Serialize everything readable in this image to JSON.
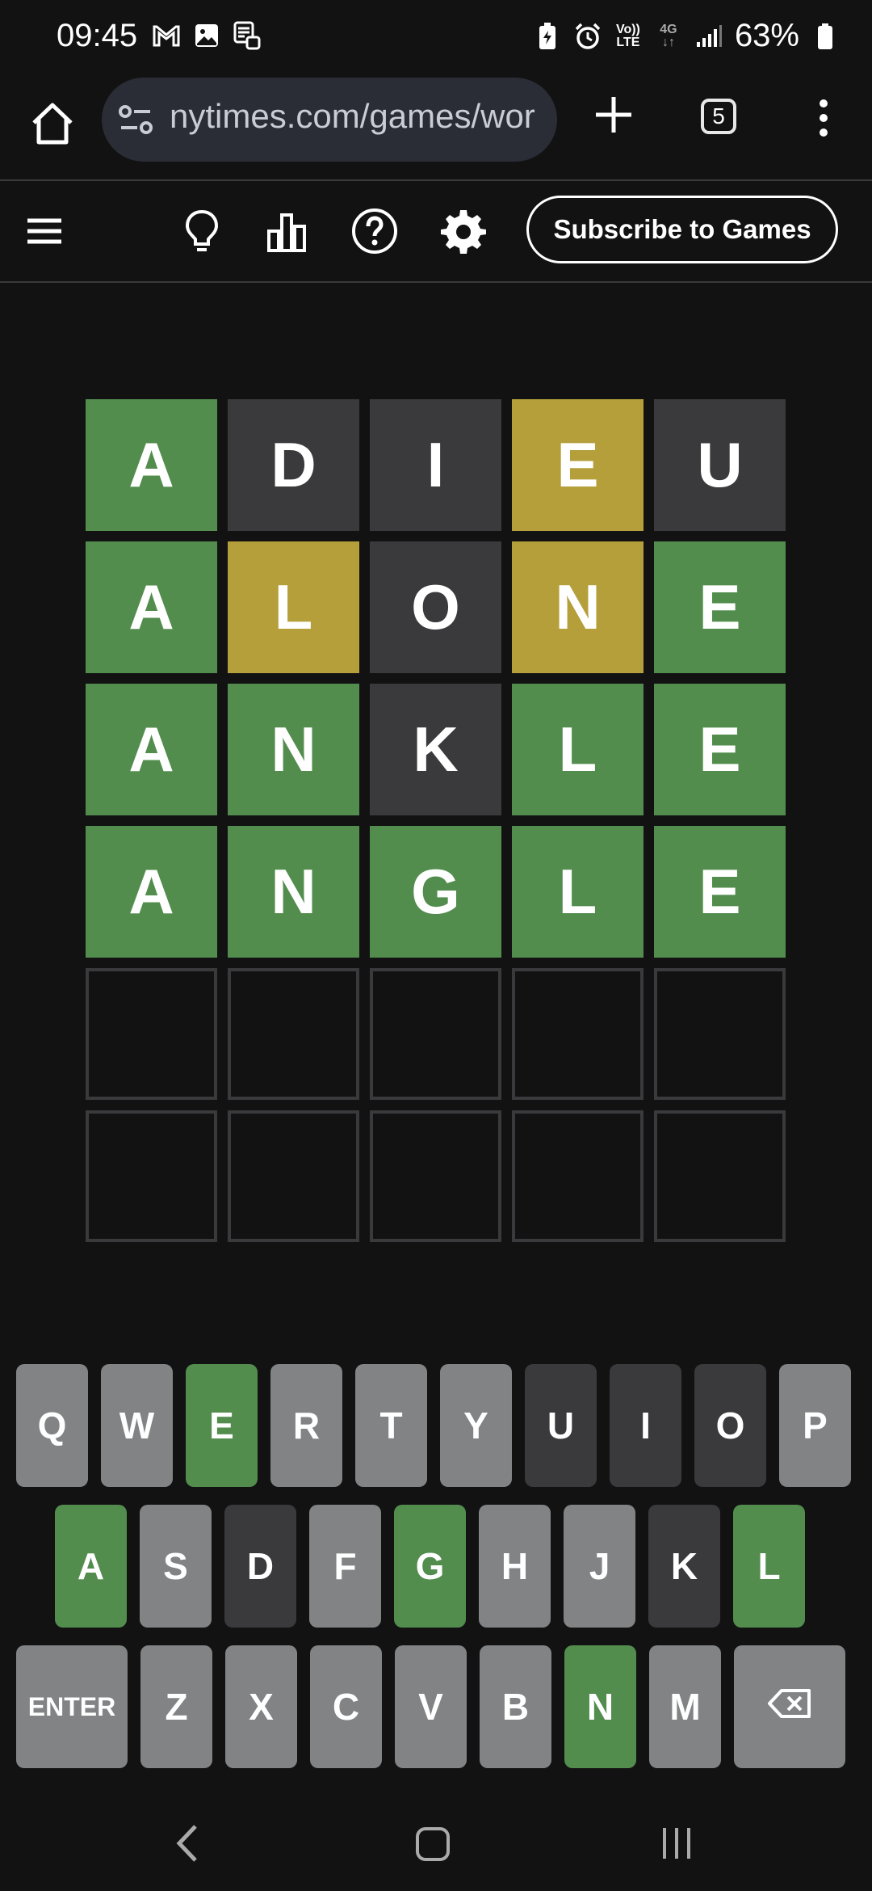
{
  "status": {
    "time": "09:45",
    "battery": "63%",
    "volte_line1": "Vo))",
    "volte_line2": "LTE",
    "net_type": "4G"
  },
  "browser": {
    "url": "nytimes.com/games/wor",
    "tab_count": "5"
  },
  "header": {
    "subscribe_label": "Subscribe to Games"
  },
  "board": {
    "rows": [
      [
        {
          "l": "A",
          "s": "correct"
        },
        {
          "l": "D",
          "s": "absent"
        },
        {
          "l": "I",
          "s": "absent"
        },
        {
          "l": "E",
          "s": "present"
        },
        {
          "l": "U",
          "s": "absent"
        }
      ],
      [
        {
          "l": "A",
          "s": "correct"
        },
        {
          "l": "L",
          "s": "present"
        },
        {
          "l": "O",
          "s": "absent"
        },
        {
          "l": "N",
          "s": "present"
        },
        {
          "l": "E",
          "s": "correct"
        }
      ],
      [
        {
          "l": "A",
          "s": "correct"
        },
        {
          "l": "N",
          "s": "correct"
        },
        {
          "l": "K",
          "s": "absent"
        },
        {
          "l": "L",
          "s": "correct"
        },
        {
          "l": "E",
          "s": "correct"
        }
      ],
      [
        {
          "l": "A",
          "s": "correct"
        },
        {
          "l": "N",
          "s": "correct"
        },
        {
          "l": "G",
          "s": "correct"
        },
        {
          "l": "L",
          "s": "correct"
        },
        {
          "l": "E",
          "s": "correct"
        }
      ],
      [
        {
          "l": "",
          "s": "empty"
        },
        {
          "l": "",
          "s": "empty"
        },
        {
          "l": "",
          "s": "empty"
        },
        {
          "l": "",
          "s": "empty"
        },
        {
          "l": "",
          "s": "empty"
        }
      ],
      [
        {
          "l": "",
          "s": "empty"
        },
        {
          "l": "",
          "s": "empty"
        },
        {
          "l": "",
          "s": "empty"
        },
        {
          "l": "",
          "s": "empty"
        },
        {
          "l": "",
          "s": "empty"
        }
      ]
    ]
  },
  "keyboard": {
    "rows": [
      [
        {
          "k": "Q",
          "s": "unused"
        },
        {
          "k": "W",
          "s": "unused"
        },
        {
          "k": "E",
          "s": "correct"
        },
        {
          "k": "R",
          "s": "unused"
        },
        {
          "k": "T",
          "s": "unused"
        },
        {
          "k": "Y",
          "s": "unused"
        },
        {
          "k": "U",
          "s": "absent"
        },
        {
          "k": "I",
          "s": "absent"
        },
        {
          "k": "O",
          "s": "absent"
        },
        {
          "k": "P",
          "s": "unused"
        }
      ],
      [
        {
          "k": "A",
          "s": "correct"
        },
        {
          "k": "S",
          "s": "unused"
        },
        {
          "k": "D",
          "s": "absent"
        },
        {
          "k": "F",
          "s": "unused"
        },
        {
          "k": "G",
          "s": "correct"
        },
        {
          "k": "H",
          "s": "unused"
        },
        {
          "k": "J",
          "s": "unused"
        },
        {
          "k": "K",
          "s": "absent"
        },
        {
          "k": "L",
          "s": "correct"
        }
      ],
      [
        {
          "k": "ENTER",
          "s": "wide"
        },
        {
          "k": "Z",
          "s": "unused"
        },
        {
          "k": "X",
          "s": "unused"
        },
        {
          "k": "C",
          "s": "unused"
        },
        {
          "k": "V",
          "s": "unused"
        },
        {
          "k": "B",
          "s": "unused"
        },
        {
          "k": "N",
          "s": "correct"
        },
        {
          "k": "M",
          "s": "unused"
        },
        {
          "k": "",
          "s": "backspace"
        }
      ]
    ]
  },
  "colors": {
    "correct": "#538d4e",
    "present": "#b59f3b",
    "absent": "#3a3a3c",
    "unused_key": "#818384",
    "background": "#121213"
  },
  "icons": {
    "status_left": [
      "gmail-icon",
      "gallery-icon",
      "screenshot-icon"
    ],
    "status_right": [
      "battery-saver-icon",
      "alarm-icon",
      "volte-icon",
      "data-4g-icon",
      "signal-icon",
      "battery-icon"
    ],
    "header": [
      "hamburger-menu-icon",
      "lightbulb-hint-icon",
      "stats-icon",
      "help-icon",
      "settings-gear-icon"
    ],
    "nav": [
      "nav-back-icon",
      "nav-home-icon",
      "nav-recents-icon"
    ]
  }
}
